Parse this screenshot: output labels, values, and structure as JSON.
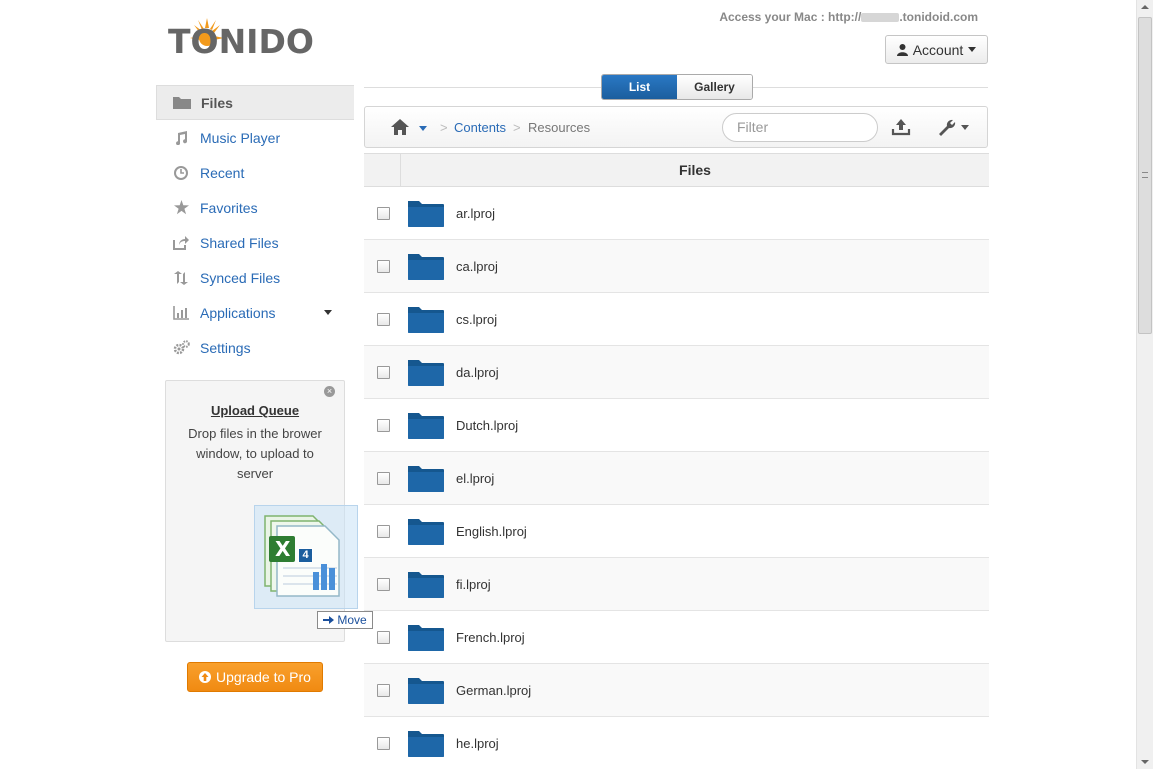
{
  "logo": {
    "text": "TONIDO"
  },
  "header": {
    "access_prefix": "Access your Mac : http://",
    "access_suffix": ".tonidoid.com",
    "account_label": "Account"
  },
  "sidebar": {
    "items": [
      {
        "label": "Files",
        "icon": "folder-icon",
        "active": true
      },
      {
        "label": "Music Player",
        "icon": "music-icon"
      },
      {
        "label": "Recent",
        "icon": "clock-icon"
      },
      {
        "label": "Favorites",
        "icon": "star-icon"
      },
      {
        "label": "Shared Files",
        "icon": "share-icon"
      },
      {
        "label": "Synced Files",
        "icon": "sync-icon"
      },
      {
        "label": "Applications",
        "icon": "chart-icon"
      },
      {
        "label": "Settings",
        "icon": "gear-icon"
      }
    ]
  },
  "upload_queue": {
    "title": "Upload Queue",
    "text": "Drop files in the brower window, to upload to server",
    "drag_badge": "4",
    "move_label": "Move"
  },
  "upgrade_label": "Upgrade to Pro",
  "view_toggle": {
    "list": "List",
    "gallery": "Gallery",
    "active": "list"
  },
  "breadcrumb": {
    "items": [
      "Contents",
      "Resources"
    ]
  },
  "filter": {
    "placeholder": "Filter"
  },
  "table": {
    "header": "Files",
    "rows": [
      "ar.lproj",
      "ca.lproj",
      "cs.lproj",
      "da.lproj",
      "Dutch.lproj",
      "el.lproj",
      "English.lproj",
      "fi.lproj",
      "French.lproj",
      "German.lproj",
      "he.lproj"
    ]
  },
  "colors": {
    "accent": "#2a6bb6",
    "folder": "#1b5e9e",
    "upgrade": "#f39318"
  }
}
